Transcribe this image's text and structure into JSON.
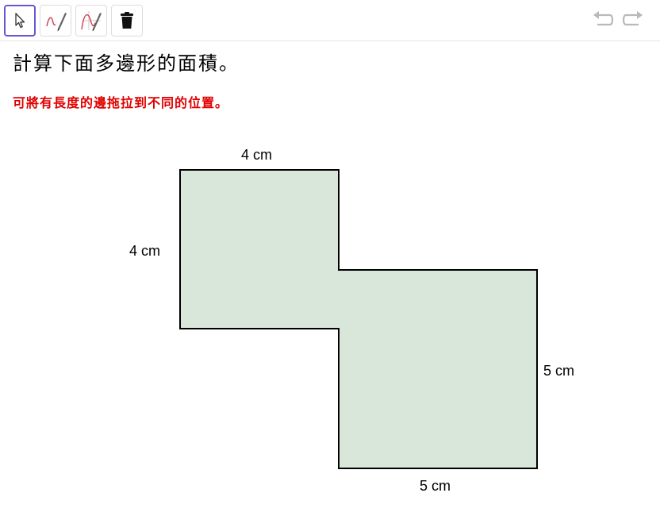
{
  "toolbar": {
    "tools": [
      {
        "name": "move-tool",
        "icon": "arrow-cursor-icon",
        "selected": true
      },
      {
        "name": "freehand-tool",
        "icon": "pen-icon",
        "selected": false
      },
      {
        "name": "function-pen-tool",
        "icon": "function-pen-icon",
        "selected": false
      },
      {
        "name": "delete-tool",
        "icon": "trash-icon",
        "selected": false
      }
    ],
    "undo_icon": "undo-icon",
    "redo_icon": "redo-icon",
    "selected_color": "#6557d2"
  },
  "question": {
    "title": "計算下面多邊形的面積。",
    "hint": "可將有長度的邊拖拉到不同的位置。",
    "hint_color": "#e00000"
  },
  "polygon": {
    "fill": "#d9e7da",
    "stroke": "#000000"
  },
  "labels": {
    "top": "4 cm",
    "left": "4 cm",
    "right": "5 cm",
    "bottom": "5 cm"
  }
}
